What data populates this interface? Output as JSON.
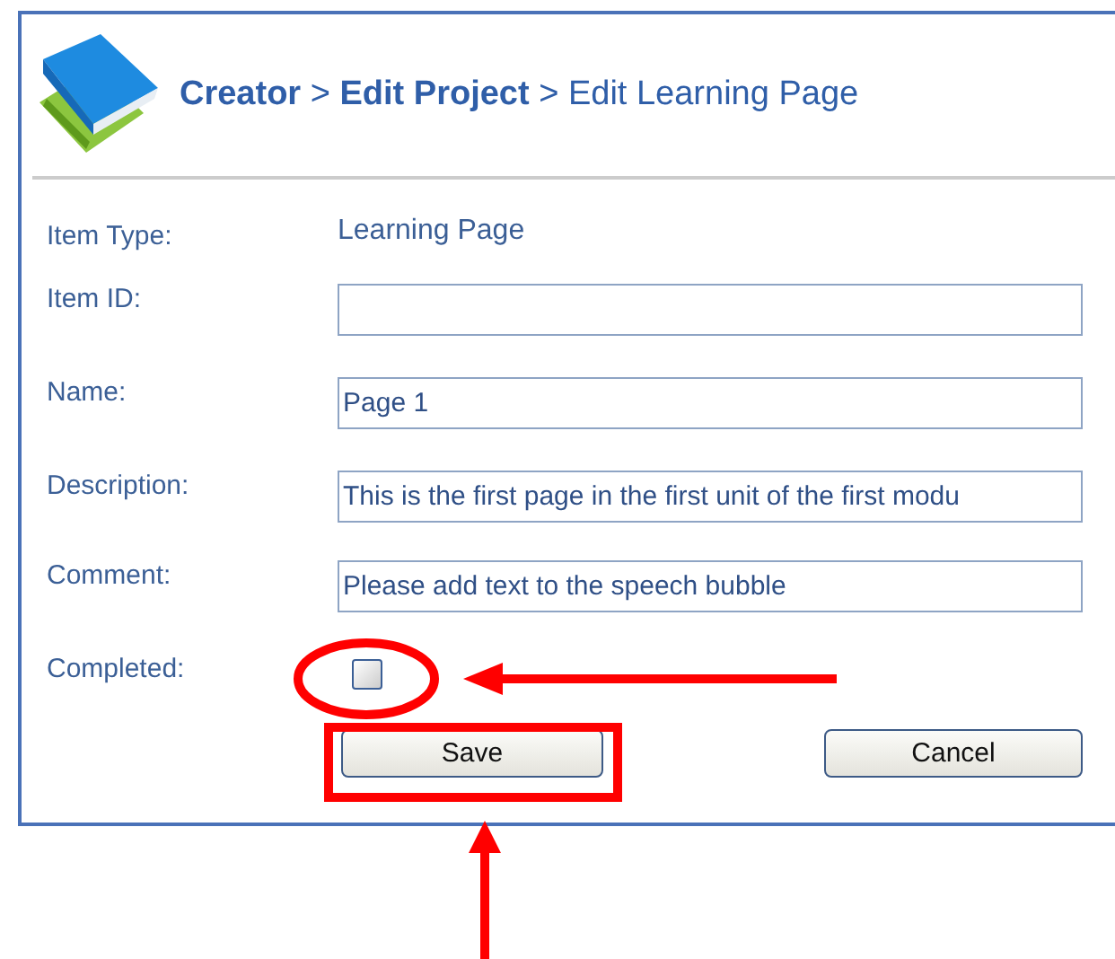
{
  "breadcrumb": "**Creator** > **Edit Project** > Edit Learning Page",
  "fields": [
    {
      "kind": "text",
      "label": "Item Type:",
      "value": "Learning Page"
    },
    {
      "kind": "input",
      "label": "Item ID:"
    },
    {
      "kind": "input",
      "label": "Name:",
      "value": "Page 1"
    },
    {
      "kind": "input",
      "label": "Description:",
      "value": "This is the first page in the first unit of the first modu"
    },
    {
      "kind": "input",
      "label": "Comment:",
      "value": "Please add text to the speech bubble"
    },
    {
      "kind": "checkbox",
      "label": "Completed:",
      "checked": false
    }
  ],
  "buttons": [
    "Save",
    "Cancel"
  ]
}
